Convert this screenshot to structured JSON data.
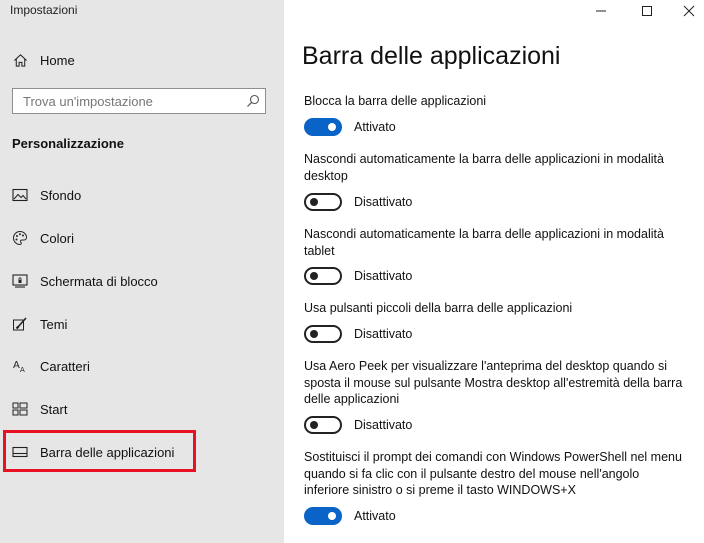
{
  "app_title": "Impostazioni",
  "sidebar": {
    "home_label": "Home",
    "search_placeholder": "Trova un'impostazione",
    "section_title": "Personalizzazione",
    "items": [
      {
        "label": "Sfondo",
        "icon": "picture-icon"
      },
      {
        "label": "Colori",
        "icon": "palette-icon"
      },
      {
        "label": "Schermata di blocco",
        "icon": "lock-screen-icon"
      },
      {
        "label": "Temi",
        "icon": "theme-brush-icon"
      },
      {
        "label": "Caratteri",
        "icon": "fonts-icon"
      },
      {
        "label": "Start",
        "icon": "start-grid-icon"
      },
      {
        "label": "Barra delle applicazioni",
        "icon": "taskbar-icon"
      }
    ],
    "highlight_color": "#e81123"
  },
  "main": {
    "title": "Barra delle applicazioni",
    "settings": [
      {
        "label": "Blocca la barra delle applicazioni",
        "state": "Attivato",
        "on": true
      },
      {
        "label": "Nascondi automaticamente la barra delle applicazioni in modalità desktop",
        "state": "Disattivato",
        "on": false
      },
      {
        "label": "Nascondi automaticamente la barra delle applicazioni in modalità tablet",
        "state": "Disattivato",
        "on": false
      },
      {
        "label": "Usa pulsanti piccoli della barra delle applicazioni",
        "state": "Disattivato",
        "on": false
      },
      {
        "label": "Usa Aero Peek per visualizzare l'anteprima del desktop quando si sposta il mouse sul pulsante Mostra desktop all'estremità della barra delle applicazioni",
        "state": "Disattivato",
        "on": false
      },
      {
        "label": "Sostituisci il prompt dei comandi con Windows PowerShell nel menu quando si fa clic con il pulsante destro del mouse nell'angolo inferiore sinistro o si preme il tasto WINDOWS+X",
        "state": "Attivato",
        "on": true
      }
    ]
  },
  "colors": {
    "accent": "#0a64c8",
    "sidebar_bg": "#e6e6e6"
  }
}
